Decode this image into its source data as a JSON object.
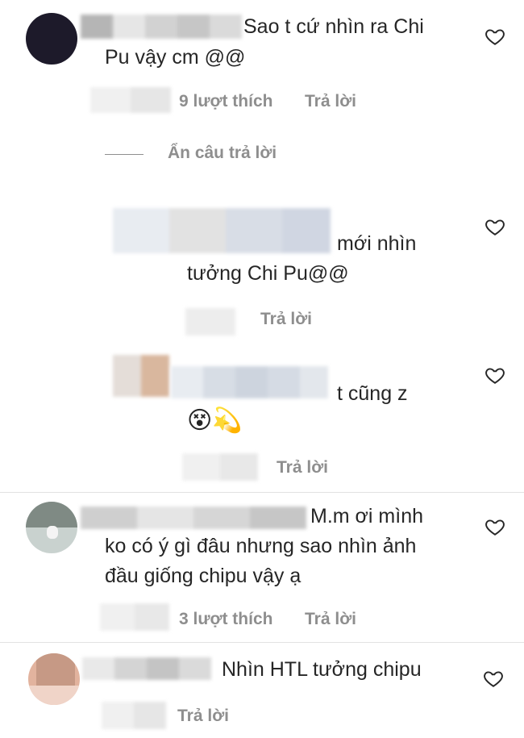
{
  "comments": [
    {
      "text_line1": "Sao t cứ nhìn ra Chi",
      "text_line2": "Pu vậy cm @@",
      "likes": "9 lượt thích",
      "reply_label": "Trả lời",
      "hide_replies_label": "Ẩn câu trả lời"
    },
    {
      "text_line1": "mới nhìn",
      "text_line2": "tưởng Chi Pu@@",
      "reply_label": "Trả lời"
    },
    {
      "text_line1": "t cũng z",
      "emoji": "😵💫",
      "reply_label": "Trả lời"
    },
    {
      "text_line1": "M.m ơi mình",
      "text_line2": "ko có ý gì đâu nhưng sao nhìn ảnh",
      "text_line3": "đầu giống chipu vậy ạ",
      "likes": "3 lượt thích",
      "reply_label": "Trả lời"
    },
    {
      "text_line1": "Nhìn HTL tưởng chipu",
      "reply_label": "Trả lời"
    }
  ],
  "colors": {
    "text": "#262626",
    "meta": "#8e8e8e",
    "heart_stroke": "#262626"
  }
}
